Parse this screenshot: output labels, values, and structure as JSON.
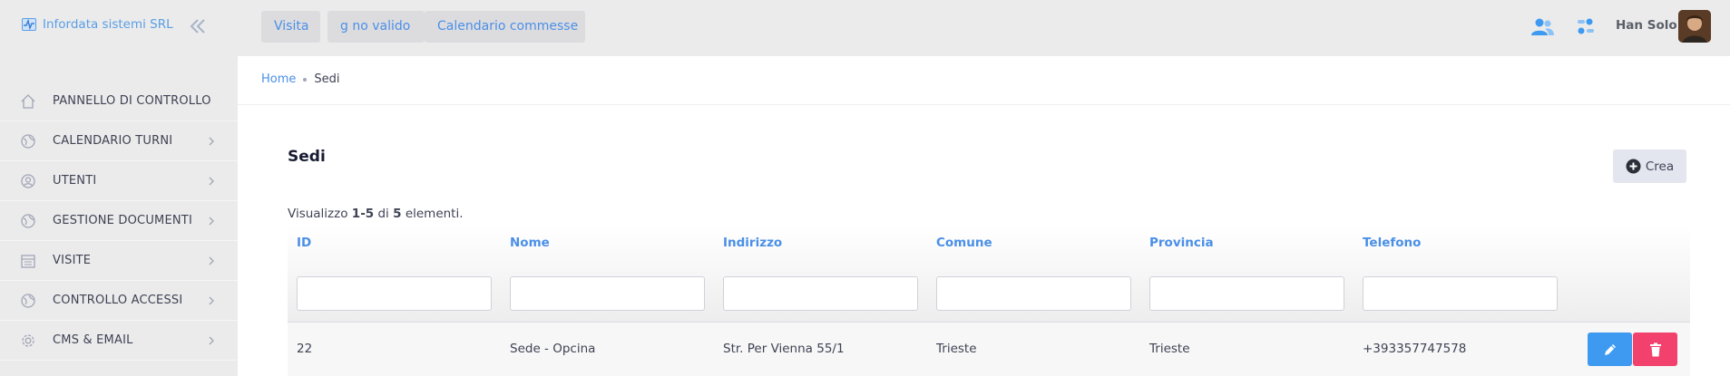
{
  "brand": {
    "name": "Infordata sistemi SRL"
  },
  "topnav": [
    {
      "label": "Visita"
    },
    {
      "label": "g no valido"
    },
    {
      "label": "Calendario commesse"
    }
  ],
  "user": {
    "name": "Han Solo"
  },
  "sidebar": {
    "items": [
      {
        "label": "PANNELLO DI CONTROLLO",
        "icon": "home-icon"
      },
      {
        "label": "CALENDARIO TURNI",
        "icon": "globe-icon"
      },
      {
        "label": "UTENTI",
        "icon": "user-circle-icon"
      },
      {
        "label": "GESTIONE DOCUMENTI",
        "icon": "globe-icon"
      },
      {
        "label": "VISITE",
        "icon": "calendar-icon"
      },
      {
        "label": "CONTROLLO ACCESSI",
        "icon": "globe-icon"
      },
      {
        "label": "CMS & EMAIL",
        "icon": "gear-icon"
      }
    ]
  },
  "breadcrumb": {
    "home": "Home",
    "current": "Sedi"
  },
  "page": {
    "title": "Sedi",
    "create_label": "Crea",
    "summary": {
      "prefix": "Visualizzo",
      "range": "1-5",
      "of": "di",
      "total": "5",
      "suffix": "elementi."
    }
  },
  "table": {
    "columns": [
      "ID",
      "Nome",
      "Indirizzo",
      "Comune",
      "Provincia",
      "Telefono"
    ],
    "rows": [
      {
        "id": "22",
        "nome": "Sede - Opcina",
        "indirizzo": "Str. Per Vienna 55/1",
        "comune": "Trieste",
        "provincia": "Trieste",
        "telefono": "+393357747578"
      }
    ]
  },
  "colors": {
    "accent": "#4a8fe7",
    "edit": "#3d9af0",
    "delete": "#f1416c",
    "sidebar_bg": "#ebebeb"
  }
}
